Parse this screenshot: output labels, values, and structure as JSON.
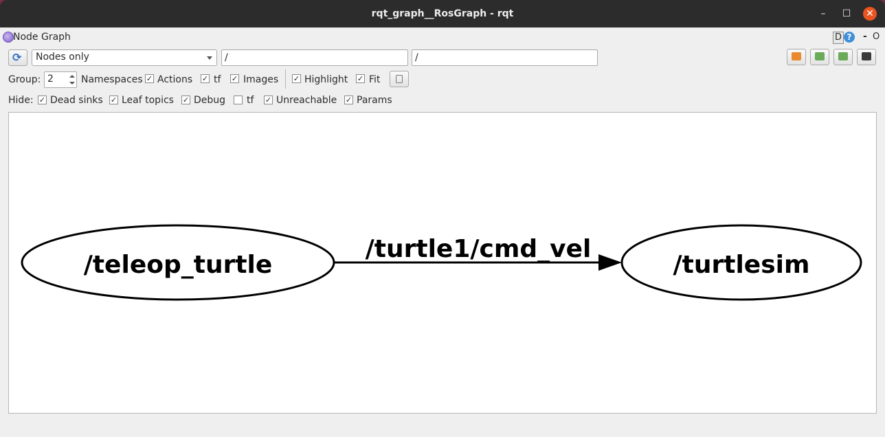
{
  "window": {
    "title": "rqt_graph__RosGraph - rqt"
  },
  "plugin": {
    "title": "Node Graph",
    "dock_d": "D",
    "dock_help": "?",
    "dock_min": "-",
    "dock_close": "O"
  },
  "toolbar": {
    "mode_selected": "Nodes only",
    "node_filter_value": "/",
    "topic_filter_value": "/"
  },
  "options": {
    "group_label": "Group:",
    "group_value": "2",
    "namespaces": {
      "label": "Namespaces",
      "checked": true
    },
    "actions": {
      "label": "Actions",
      "checked": true
    },
    "tf": {
      "label": "tf",
      "checked": true
    },
    "images": {
      "label": "Images",
      "checked": true
    },
    "highlight": {
      "label": "Highlight",
      "checked": true
    },
    "fit": {
      "label": "Fit",
      "checked": true
    }
  },
  "hide": {
    "label": "Hide:",
    "dead_sinks": {
      "label": "Dead sinks",
      "checked": true
    },
    "leaf_topics": {
      "label": "Leaf topics",
      "checked": true
    },
    "debug": {
      "label": "Debug",
      "checked": true
    },
    "tf": {
      "label": "tf",
      "checked": false
    },
    "unreachable": {
      "label": "Unreachable",
      "checked": true
    },
    "params": {
      "label": "Params",
      "checked": true
    }
  },
  "graph": {
    "nodes": [
      {
        "label": "/teleop_turtle"
      },
      {
        "label": "/turtlesim"
      }
    ],
    "edges": [
      {
        "label": "/turtle1/cmd_vel",
        "from": "/teleop_turtle",
        "to": "/turtlesim"
      }
    ]
  },
  "colors": {
    "accent": "#e95420",
    "titlebar": "#2c2c2c",
    "refresh": "#2f6fc4",
    "help": "#3e8fd9"
  }
}
